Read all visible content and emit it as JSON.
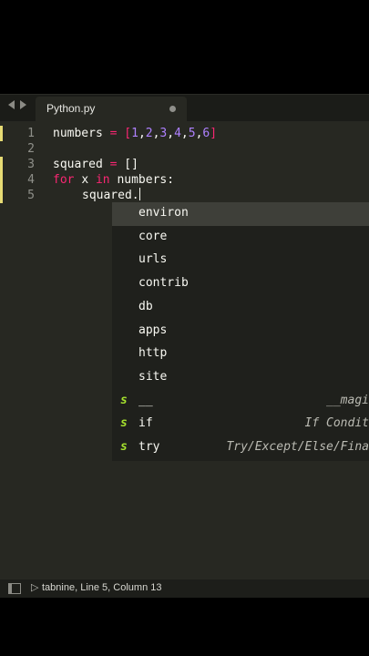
{
  "tabs": [
    {
      "label": "Python.py",
      "modified": true
    }
  ],
  "gutter": {
    "line_numbers": [
      "1",
      "2",
      "3",
      "4",
      "5"
    ]
  },
  "code": {
    "line1": {
      "var": "numbers",
      "eq": "=",
      "lb": "[",
      "n1": "1",
      "n2": "2",
      "n3": "3",
      "n4": "4",
      "n5": "5",
      "n6": "6",
      "comma": ",",
      "rb": "]"
    },
    "line3": {
      "var": "squared",
      "eq": "=",
      "list": "[]"
    },
    "line4": {
      "kw_for": "for",
      "x": "x",
      "kw_in": "in",
      "rest": "numbers:"
    },
    "line5": {
      "text": "squared."
    }
  },
  "autocomplete": {
    "items": [
      {
        "label": "environ",
        "hint": "",
        "snippet": false,
        "selected": true
      },
      {
        "label": "core",
        "hint": "",
        "snippet": false
      },
      {
        "label": "urls",
        "hint": "",
        "snippet": false
      },
      {
        "label": "contrib",
        "hint": "",
        "snippet": false
      },
      {
        "label": "db",
        "hint": "",
        "snippet": false
      },
      {
        "label": "apps",
        "hint": "",
        "snippet": false
      },
      {
        "label": "http",
        "hint": "",
        "snippet": false
      },
      {
        "label": "site",
        "hint": "",
        "snippet": false
      },
      {
        "label": "__",
        "hint": "__magi",
        "snippet": true,
        "snippet_mark": "s"
      },
      {
        "label": "if",
        "hint": "If Condit",
        "snippet": true,
        "snippet_mark": "s"
      },
      {
        "label": "try",
        "hint": "Try/Except/Else/Fina",
        "snippet": true,
        "snippet_mark": "s"
      }
    ]
  },
  "status": {
    "icon": "tabnine-icon",
    "text": "tabnine, Line 5, Column 13"
  },
  "colors": {
    "background": "#272822",
    "keyword": "#f92672",
    "number": "#ae81ff",
    "snippet": "#a6e22e",
    "modified_marker": "#e6db74"
  }
}
